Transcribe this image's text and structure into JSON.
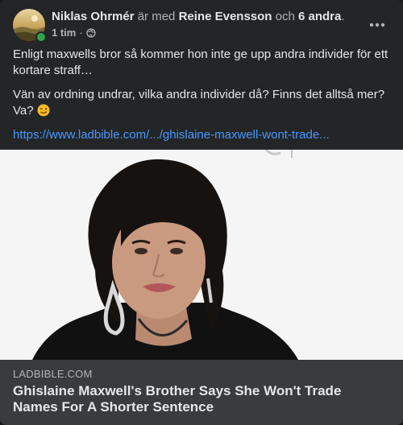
{
  "post": {
    "author": "Niklas Ohrmér",
    "with_text": "är med",
    "tagged": "Reine Evensson",
    "and_text": "och",
    "others": "6 andra",
    "period": ".",
    "time": "1 tim",
    "separator": "·",
    "privacy_icon": "globe-icon",
    "paragraph1": "Enligt maxwells bror så kommer hon inte ge upp andra individer för ett kortare straff…",
    "paragraph2": "Vän av ordning undrar, vilka andra individer då? Finns det alltså mer? Va?",
    "link_text": "https://www.ladbible.com/.../ghislaine-maxwell-wont-trade...",
    "emoji": "winking-face-icon"
  },
  "link_card": {
    "domain": "LADBIBLE.COM",
    "headline": "Ghislaine Maxwell's Brother Says She Won't Trade Names For A Shorter Sentence"
  },
  "colors": {
    "background": "#242526",
    "text": "#e4e6eb",
    "secondary": "#b0b3b8",
    "link": "#4599ff",
    "online": "#31a24c",
    "card_footer": "#3a3b3c"
  }
}
